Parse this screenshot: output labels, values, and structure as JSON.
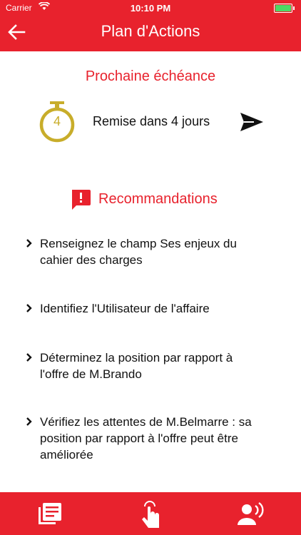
{
  "status_bar": {
    "carrier": "Carrier",
    "time": "10:10 PM"
  },
  "header": {
    "title": "Plan d'Actions"
  },
  "deadline": {
    "heading": "Prochaine échéance",
    "timer_value": "4",
    "text": "Remise dans 4 jours"
  },
  "recommendations": {
    "heading": "Recommandations",
    "items": [
      {
        "line1": "Renseignez le champ Ses enjeux du",
        "line2": "cahier des charges",
        "line3": ""
      },
      {
        "line1": "Identifiez l'Utilisateur de l'affaire",
        "line2": "",
        "line3": ""
      },
      {
        "line1": "Déterminez la position par rapport à",
        "line2": "l'offre de M.Brando",
        "line3": ""
      },
      {
        "line1": "Vérifiez les attentes de M.Belmarre : sa",
        "line2": "position par rapport à l'offre peut être",
        "line3": "améliorée"
      }
    ]
  },
  "colors": {
    "brand_red": "#e8222d",
    "timer_gold": "#c8ad2a",
    "battery_green": "#4cd964"
  },
  "icons": {
    "back": "arrow-left-icon",
    "send": "send-icon",
    "timer": "stopwatch-icon",
    "alert": "alert-bubble-icon",
    "tab1": "list-icon",
    "tab2": "touch-icon",
    "tab3": "voice-icon"
  }
}
